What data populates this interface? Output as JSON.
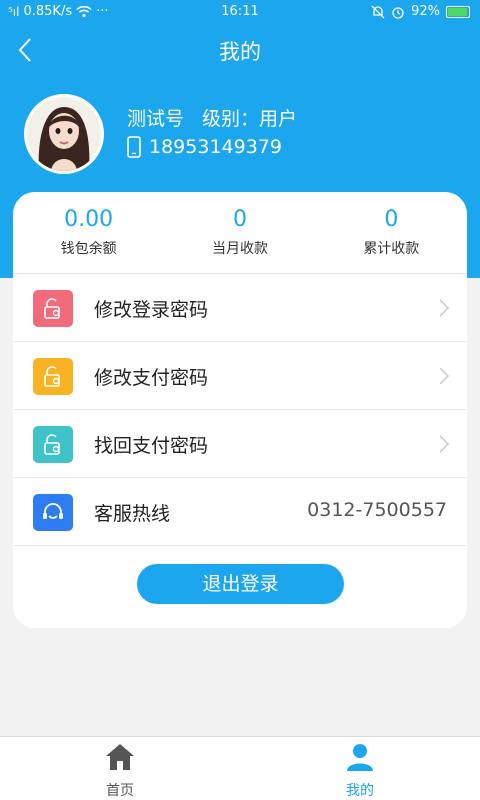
{
  "status_bar": {
    "signal": "⁵ıl",
    "speed": "0.85K/s",
    "dots": "···",
    "time": "16:11",
    "battery_percent": "92%",
    "battery_level": 0.92
  },
  "nav": {
    "title": "我的",
    "back_icon": "chevron-left-icon"
  },
  "user": {
    "account_type": "测试号",
    "level_label": "级别：用户",
    "phone": "18953149379",
    "phone_icon": "mobile-phone-icon"
  },
  "stats": [
    {
      "value": "0.00",
      "label": "钱包余额"
    },
    {
      "value": "0",
      "label": "当月收款"
    },
    {
      "value": "0",
      "label": "累计收款"
    }
  ],
  "menu": [
    {
      "label": "修改登录密码",
      "icon": "unlock-gear-icon",
      "color": "#f26b7a"
    },
    {
      "label": "修改支付密码",
      "icon": "unlock-gear-icon",
      "color": "#f7b324"
    },
    {
      "label": "找回支付密码",
      "icon": "unlock-gear-icon",
      "color": "#3ec3c9"
    },
    {
      "label": "客服热线",
      "icon": "headset-icon",
      "color": "#2d7cf0",
      "value": "0312-7500557"
    }
  ],
  "logout_label": "退出登录",
  "tabbar": [
    {
      "label": "首页",
      "icon": "home-icon",
      "active": false
    },
    {
      "label": "我的",
      "icon": "user-icon",
      "active": true
    }
  ],
  "colors": {
    "accent": "#1ba6ee",
    "tab_inactive": "#555555",
    "tab_active": "#1ba6ee"
  }
}
